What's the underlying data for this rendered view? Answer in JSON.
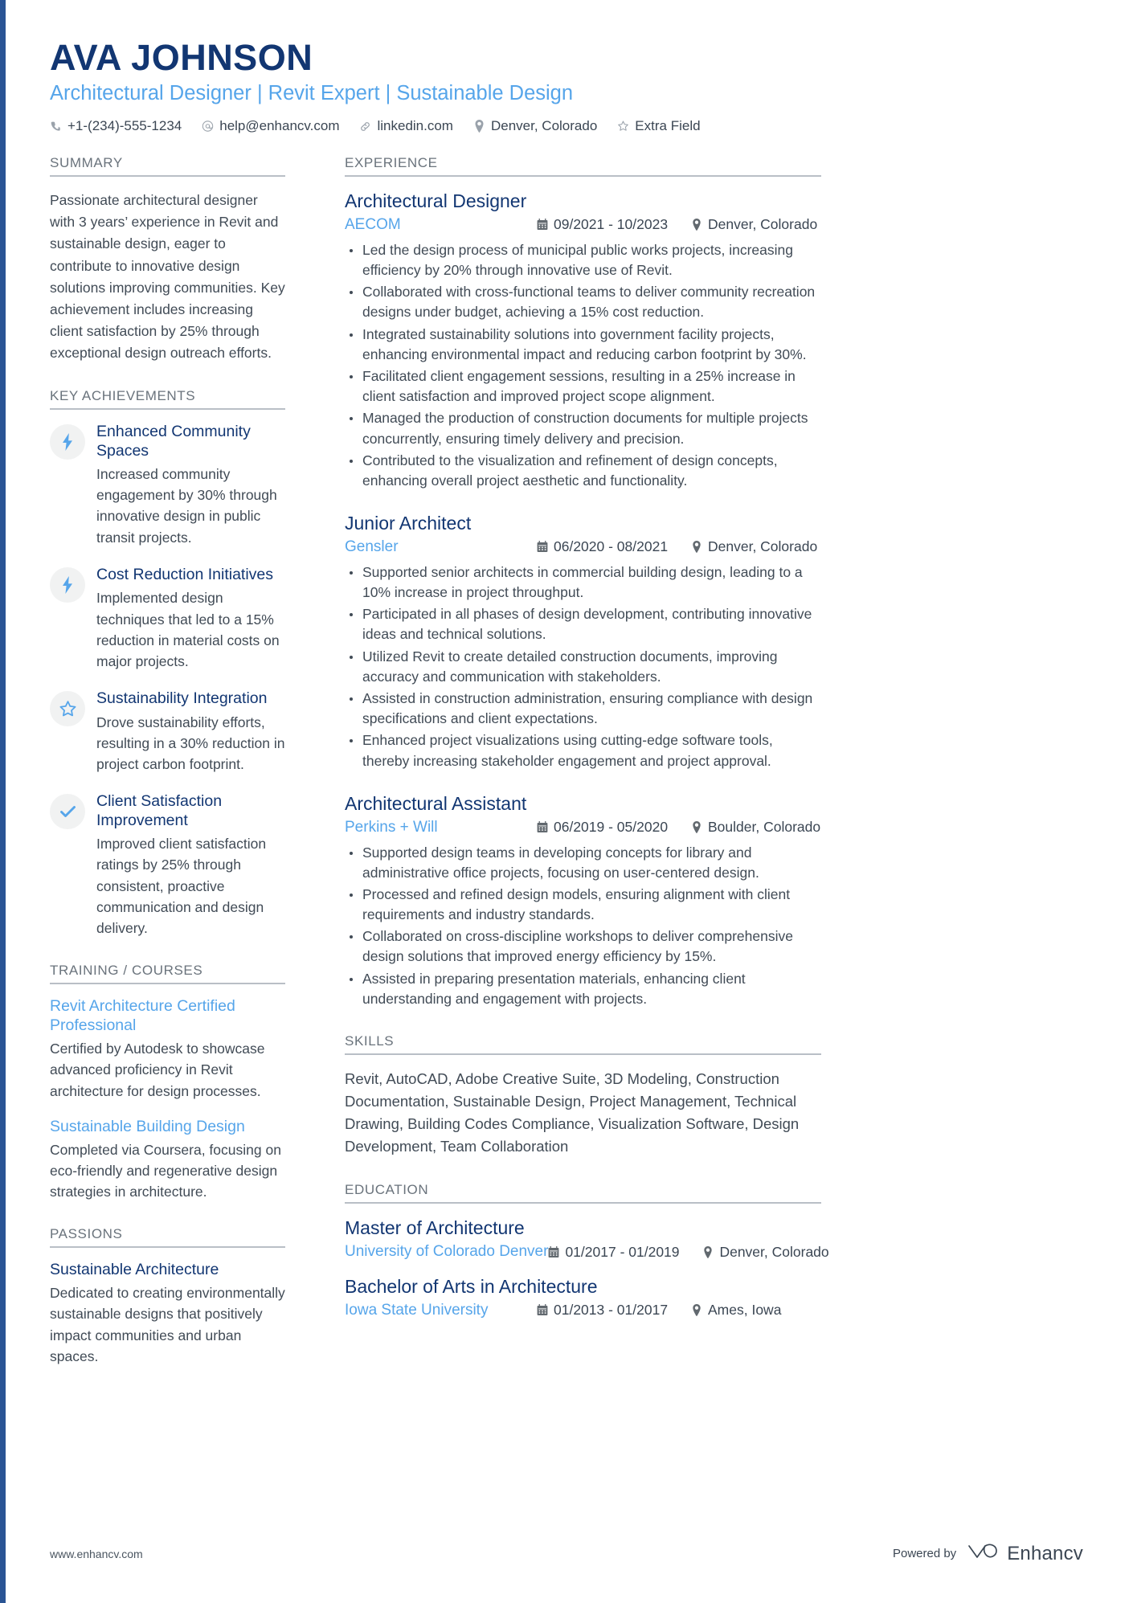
{
  "theme": {
    "navy": "#123672",
    "light_blue": "#56a5ea",
    "body_gray": "#414b56",
    "rule_gray": "#b9bfc6",
    "accent_bar": "#2a5494"
  },
  "header": {
    "name": "AVA JOHNSON",
    "tagline": "Architectural Designer | Revit Expert | Sustainable Design",
    "contacts": [
      {
        "icon": "phone-icon",
        "text": "+1-(234)-555-1234"
      },
      {
        "icon": "email-icon",
        "text": "help@enhancv.com"
      },
      {
        "icon": "link-icon",
        "text": "linkedin.com"
      },
      {
        "icon": "location-icon",
        "text": "Denver, Colorado"
      },
      {
        "icon": "star-icon",
        "text": "Extra Field"
      }
    ]
  },
  "sidebar": {
    "summary": {
      "title": "SUMMARY",
      "text": "Passionate architectural designer with 3 years’ experience in Revit and sustainable design, eager to contribute to innovative design solutions improving communities. Key achievement includes increasing client satisfaction by 25% through exceptional design outreach efforts."
    },
    "key_achievements": {
      "title": "KEY ACHIEVEMENTS",
      "items": [
        {
          "icon": "lightning-bolt-icon",
          "title": "Enhanced Community Spaces",
          "desc": "Increased community engagement by 30% through innovative design in public transit projects."
        },
        {
          "icon": "lightning-bolt-icon",
          "title": "Cost Reduction Initiatives",
          "desc": "Implemented design techniques that led to a 15% reduction in material costs on major projects."
        },
        {
          "icon": "star-outline-icon",
          "title": "Sustainability Integration",
          "desc": "Drove sustainability efforts, resulting in a 30% reduction in project carbon footprint."
        },
        {
          "icon": "check-icon",
          "title": "Client Satisfaction Improvement",
          "desc": "Improved client satisfaction ratings by 25% through consistent, proactive communication and design delivery."
        }
      ]
    },
    "training": {
      "title": "TRAINING / COURSES",
      "items": [
        {
          "title": "Revit Architecture Certified Professional",
          "desc": "Certified by Autodesk to showcase advanced proficiency in Revit architecture for design processes."
        },
        {
          "title": "Sustainable Building Design",
          "desc": "Completed via Coursera, focusing on eco-friendly and regenerative design strategies in architecture."
        }
      ]
    },
    "passions": {
      "title": "PASSIONS",
      "items": [
        {
          "title": "Sustainable Architecture",
          "desc": "Dedicated to creating environmentally sustainable designs that positively impact communities and urban spaces."
        }
      ]
    }
  },
  "main": {
    "experience": {
      "title": "EXPERIENCE",
      "jobs": [
        {
          "role": "Architectural Designer",
          "company": "AECOM",
          "dates": "09/2021 - 10/2023",
          "location": "Denver, Colorado",
          "bullets": [
            "Led the design process of municipal public works projects, increasing efficiency by 20% through innovative use of Revit.",
            "Collaborated with cross-functional teams to deliver community recreation designs under budget, achieving a 15% cost reduction.",
            "Integrated sustainability solutions into government facility projects, enhancing environmental impact and reducing carbon footprint by 30%.",
            "Facilitated client engagement sessions, resulting in a 25% increase in client satisfaction and improved project scope alignment.",
            "Managed the production of construction documents for multiple projects concurrently, ensuring timely delivery and precision.",
            "Contributed to the visualization and refinement of design concepts, enhancing overall project aesthetic and functionality."
          ]
        },
        {
          "role": "Junior Architect",
          "company": "Gensler",
          "dates": "06/2020 - 08/2021",
          "location": "Denver, Colorado",
          "bullets": [
            "Supported senior architects in commercial building design, leading to a 10% increase in project throughput.",
            "Participated in all phases of design development, contributing innovative ideas and technical solutions.",
            "Utilized Revit to create detailed construction documents, improving accuracy and communication with stakeholders.",
            "Assisted in construction administration, ensuring compliance with design specifications and client expectations.",
            "Enhanced project visualizations using cutting-edge software tools, thereby increasing stakeholder engagement and project approval."
          ]
        },
        {
          "role": "Architectural Assistant",
          "company": "Perkins + Will",
          "dates": "06/2019 - 05/2020",
          "location": "Boulder, Colorado",
          "bullets": [
            "Supported design teams in developing concepts for library and administrative office projects, focusing on user-centered design.",
            "Processed and refined design models, ensuring alignment with client requirements and industry standards.",
            "Collaborated on cross-discipline workshops to deliver comprehensive design solutions that improved energy efficiency by 15%.",
            "Assisted in preparing presentation materials, enhancing client understanding and engagement with projects."
          ]
        }
      ]
    },
    "skills": {
      "title": "SKILLS",
      "text": "Revit, AutoCAD, Adobe Creative Suite, 3D Modeling, Construction Documentation, Sustainable Design, Project Management, Technical Drawing, Building Codes Compliance, Visualization Software, Design Development, Team Collaboration"
    },
    "education": {
      "title": "EDUCATION",
      "items": [
        {
          "degree": "Master of Architecture",
          "school": "University of Colorado Denver",
          "dates": "01/2017 - 01/2019",
          "location": "Denver, Colorado"
        },
        {
          "degree": "Bachelor of Arts in Architecture",
          "school": "Iowa State University",
          "dates": "01/2013 - 01/2017",
          "location": "Ames, Iowa"
        }
      ]
    }
  },
  "footer": {
    "url": "www.enhancv.com",
    "powered_by": "Powered by",
    "brand": "Enhancv"
  }
}
